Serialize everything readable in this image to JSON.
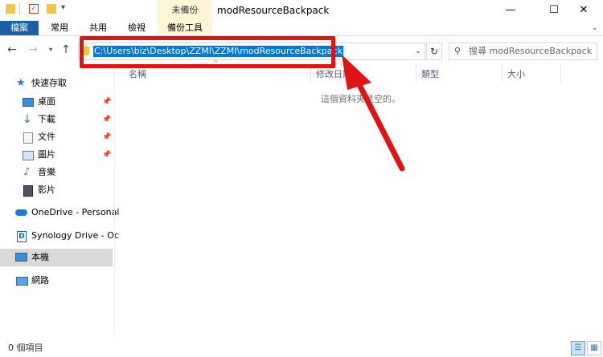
{
  "window": {
    "title": "modResourceBackpack",
    "context_tab_title": "未備份",
    "controls": {
      "minimize": "—",
      "maximize": "☐",
      "close": "✕"
    }
  },
  "ribbon": {
    "tabs": [
      "檔案",
      "常用",
      "共用",
      "檢視",
      "備份工具"
    ]
  },
  "address_bar": {
    "path": "C:\\Users\\biz\\Desktop\\ZZMI\\ZZMI\\modResourceBackpack",
    "search_placeholder": "搜尋 modResourceBackpack"
  },
  "nav_pane": {
    "quick_access": "快速存取",
    "items": [
      {
        "label": "桌面",
        "icon": "desktop-icon",
        "pinned": true
      },
      {
        "label": "下載",
        "icon": "download-icon",
        "pinned": true
      },
      {
        "label": "文件",
        "icon": "documents-icon",
        "pinned": true
      },
      {
        "label": "圖片",
        "icon": "pictures-icon",
        "pinned": true
      },
      {
        "label": "音樂",
        "icon": "music-icon",
        "pinned": false
      },
      {
        "label": "影片",
        "icon": "videos-icon",
        "pinned": false
      }
    ],
    "onedrive": "OneDrive - Personal",
    "synology": "Synology Drive - Oc",
    "this_pc": "本機",
    "network": "網路"
  },
  "file_list": {
    "columns": [
      "名稱",
      "修改日期",
      "類型",
      "大小"
    ],
    "empty_message": "這個資料夾是空的。"
  },
  "status_bar": {
    "item_count": "0 個項目"
  },
  "colors": {
    "accent": "#0078d7",
    "file_tab": "#1a5fa8",
    "annotation": "#e01414",
    "context_tab": "#fff6d6"
  }
}
